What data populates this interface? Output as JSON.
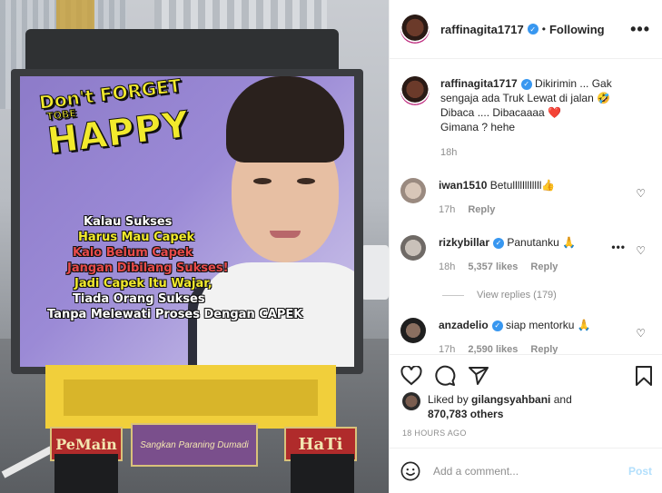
{
  "post": {
    "author": "raffinagita1717",
    "follow_status": "Following",
    "separator": "•",
    "more_glyph": "•••",
    "caption_lines": [
      "Dikirimin ... Gak",
      "sengaja ada Truk Lewat di jalan 🤣",
      "Dibaca .... Dibacaaaa ❤️",
      "Gimana ? hehe"
    ],
    "caption_time": "18h"
  },
  "image": {
    "slogan_dont": "Don't FORGET",
    "slogan_tobe": "TOBE",
    "slogan_happy": "HAPPY",
    "lines": [
      "Kalau Sukses",
      "Harus Mau Capek",
      "Kalo Belum Capek",
      "Jangan Dibilang Sukses!",
      "Jadi Capek Itu Wajar,",
      "Tiada Orang Sukses",
      "Tanpa Melewati Proses Dengan CAPEK"
    ],
    "plate_left": "PeMain",
    "plate_mid": "Sangkan Paraning Dumadi",
    "plate_right": "HaTi"
  },
  "comments": [
    {
      "user": "iwan1510",
      "verified": false,
      "text": "Betullllllllllll👍",
      "time": "17h",
      "likes": "",
      "reply": "Reply"
    },
    {
      "user": "rizkybillar",
      "verified": true,
      "text": "Panutanku 🙏",
      "time": "18h",
      "likes": "5,357 likes",
      "reply": "Reply"
    },
    {
      "user": "anzadelio",
      "verified": true,
      "text": "siap mentorku 🙏",
      "time": "17h",
      "likes": "2,590 likes",
      "reply": "Reply"
    }
  ],
  "view_replies": "View replies (179)",
  "likes_line1_prefix": "Liked by ",
  "likes_user": "gilangsyahbani",
  "likes_and": " and",
  "likes_count": "870,783 others",
  "time_ago": "18 HOURS AGO",
  "add_comment_placeholder": "Add a comment...",
  "post_button": "Post",
  "colors": {
    "verified": "#3897f0",
    "link": "#b2dffc",
    "muted": "#8e8e8e",
    "heart": "#ed4956"
  },
  "icons": [
    "more-icon",
    "verified-icon",
    "heart-icon",
    "comment-icon",
    "share-icon",
    "bookmark-icon",
    "emoji-icon"
  ]
}
